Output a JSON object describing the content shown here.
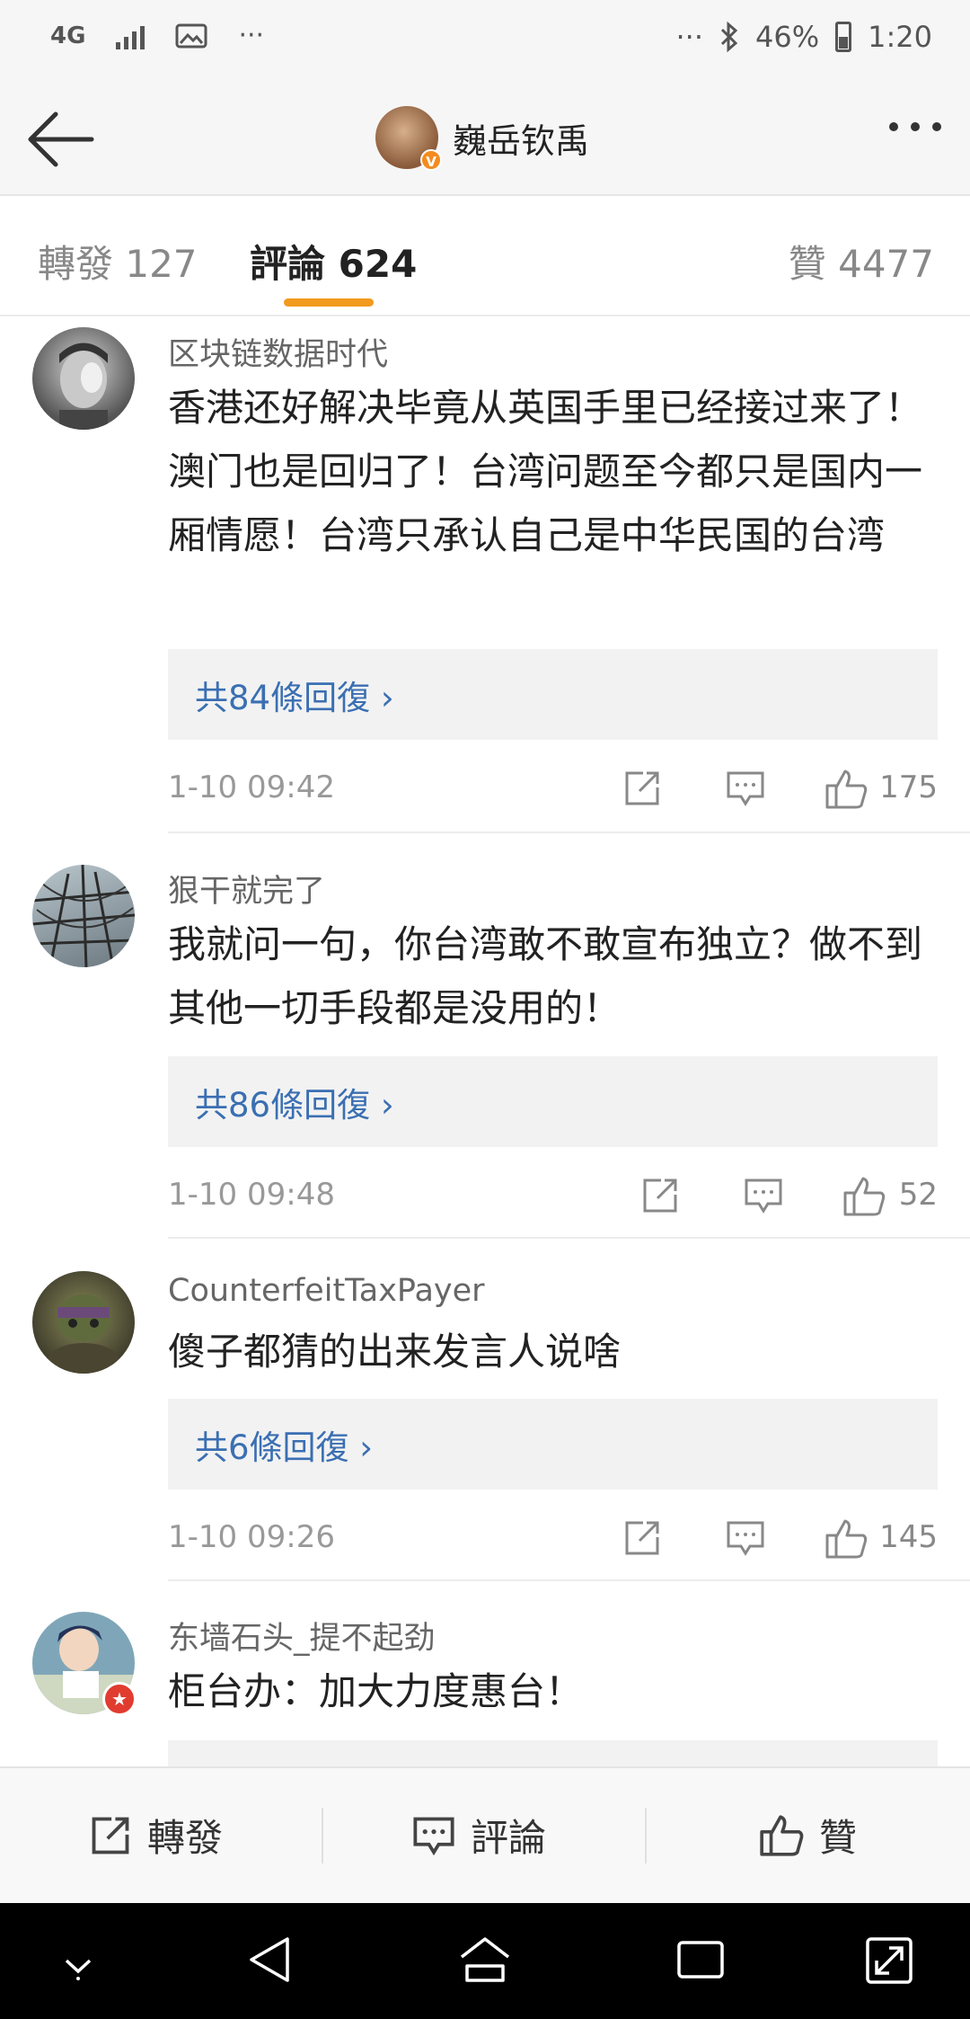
{
  "status_bar": {
    "network": "4G",
    "more_left": "···",
    "more_right": "···",
    "battery": "46%",
    "time": "1:20"
  },
  "header": {
    "title": "巍岳钦禹",
    "icons": [
      "back-arrow-icon",
      "verified-badge-icon",
      "more-dots-icon"
    ],
    "badge_text": "V"
  },
  "tabs": [
    {
      "label": "轉發 127"
    },
    {
      "label": "評論 624"
    },
    {
      "label": "贊 4477"
    }
  ],
  "accent_color": "#f29a1e",
  "link_color": "#3a6fb2",
  "comments": [
    {
      "user": "区块链数据时代",
      "text": "香港还好解决毕竟从英国手里已经接过来了！澳门也是回归了！台湾问题至今都只是国内一厢情愿！台湾只承认自己是中华民国的台湾",
      "replies": "共84條回復 ›",
      "time": "1-10 09:42",
      "likes": "175"
    },
    {
      "user": "狠干就完了",
      "text": "我就问一句，你台湾敢不敢宣布独立？做不到其他一切手段都是没用的！",
      "replies": "共86條回復 ›",
      "time": "1-10 09:48",
      "likes": "52"
    },
    {
      "user": "CounterfeitTaxPayer",
      "text": "傻子都猜的出来发言人说啥",
      "replies": "共6條回復 ›",
      "time": "1-10 09:26",
      "likes": "145"
    },
    {
      "user": "东墙石头_提不起劲",
      "text": "柜台办：加大力度惠台！"
    }
  ],
  "bottom_bar": {
    "repost": "轉發",
    "comment": "評論",
    "like": "贊"
  }
}
